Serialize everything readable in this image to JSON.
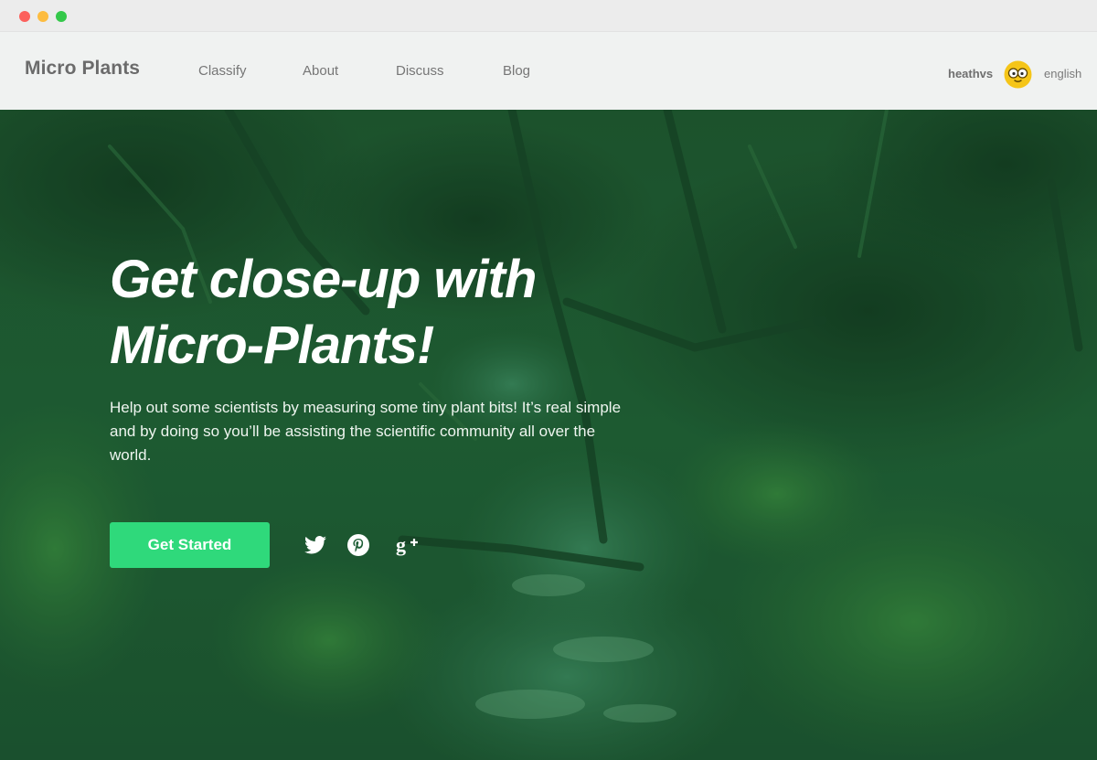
{
  "window": {
    "controls": [
      "close",
      "minimize",
      "zoom"
    ]
  },
  "nav": {
    "brand": "Micro Plants",
    "links": [
      {
        "label": "Classify"
      },
      {
        "label": "About"
      },
      {
        "label": "Discuss"
      },
      {
        "label": "Blog"
      }
    ],
    "user": {
      "name": "heathvs",
      "avatar_icon": "cartoon-character-avatar"
    },
    "language": "english"
  },
  "hero": {
    "headline_line1": "Get close-up with",
    "headline_line2": "Micro-Plants!",
    "description": "Help out some scientists by measuring some tiny plant bits! It’s real simple and by doing so you’ll be assisting the scientific community all over the world.",
    "cta_label": "Get Started",
    "social": [
      {
        "name": "twitter-icon"
      },
      {
        "name": "pinterest-icon"
      },
      {
        "name": "google-plus-icon"
      }
    ]
  },
  "colors": {
    "accent": "#2fd97b",
    "overlay": "#1c5a33",
    "nav_bg": "#f8f8f8"
  }
}
